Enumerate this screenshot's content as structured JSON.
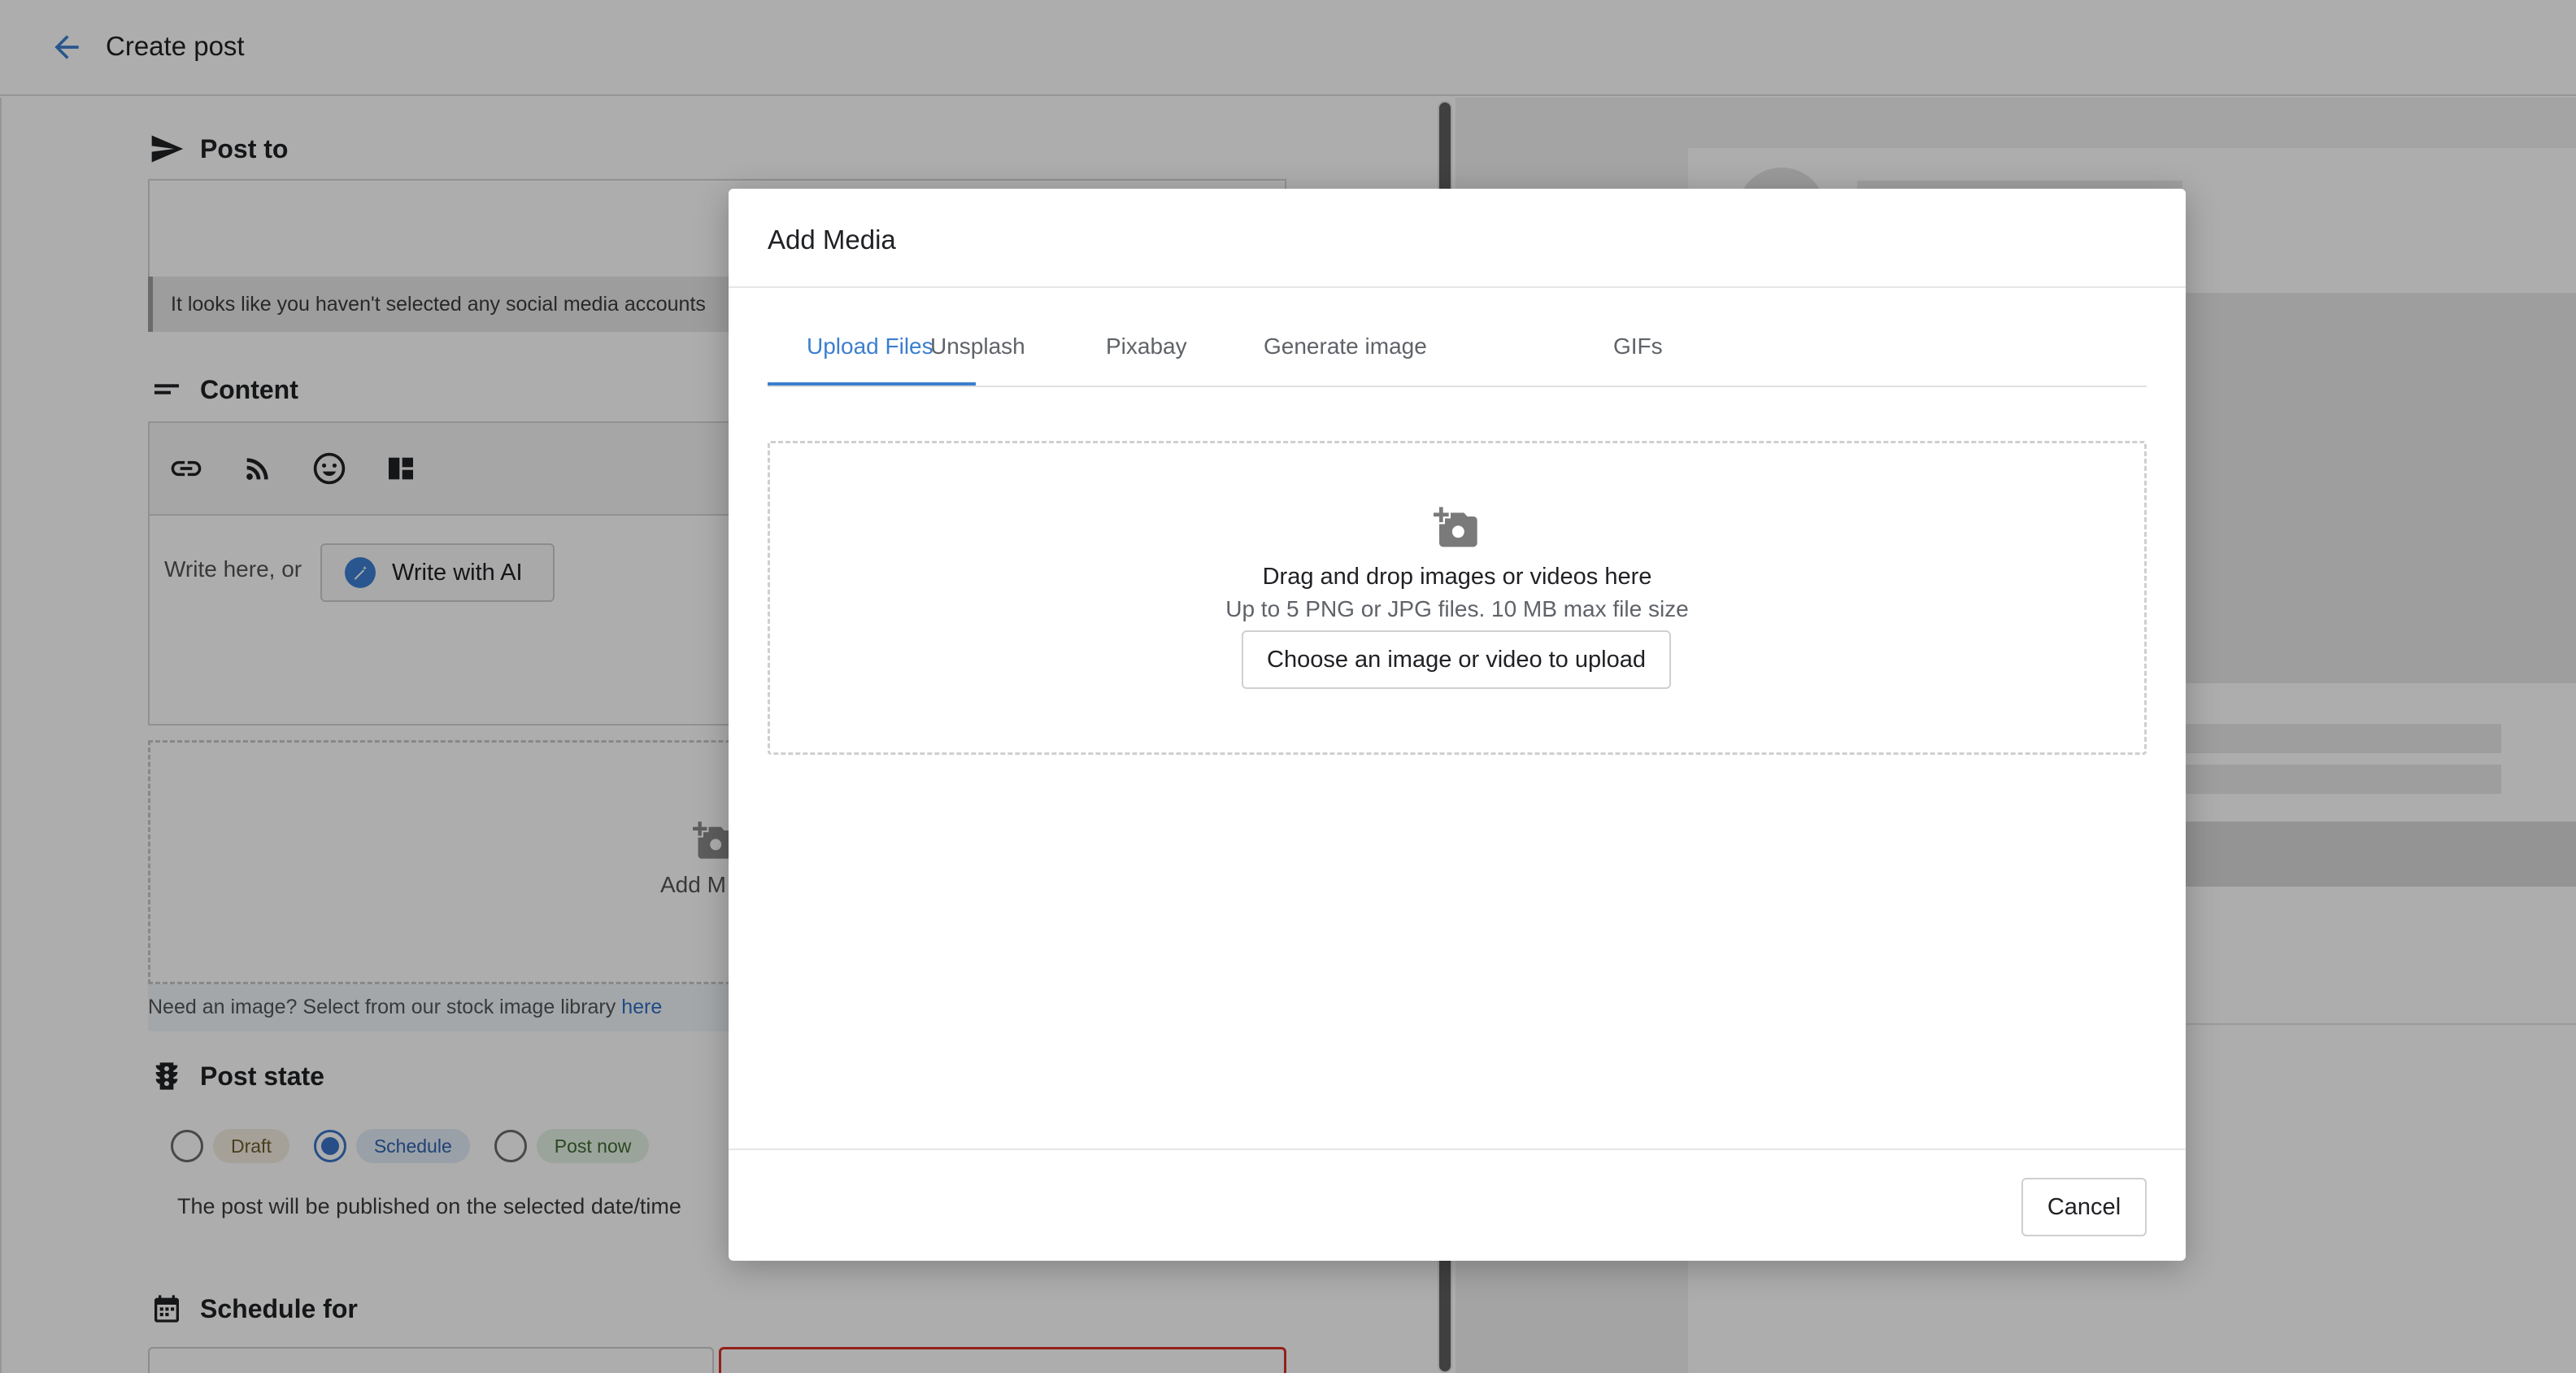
{
  "header": {
    "title": "Create post",
    "back_icon": "arrow-left-icon"
  },
  "post_to": {
    "heading": "Post to",
    "icon": "send-icon",
    "notice": "It looks like you haven't selected any social media accounts"
  },
  "content": {
    "heading": "Content",
    "icon": "text-lines-icon",
    "toolbar_icons": [
      "link-icon",
      "rss-icon",
      "emoji-icon",
      "layout-grid-icon"
    ],
    "placeholder": "Write here, or",
    "ai_button_label": "Write with AI",
    "media_label": "Add M",
    "stock_note": "Need an image? Select from our stock image library",
    "stock_link": "here"
  },
  "post_state": {
    "heading": "Post state",
    "icon": "traffic-light-icon",
    "options": [
      {
        "label": "Draft",
        "checked": false
      },
      {
        "label": "Schedule",
        "checked": true
      },
      {
        "label": "Post now",
        "checked": false
      }
    ],
    "description": "The post will be published on the selected date/time"
  },
  "schedule": {
    "heading": "Schedule for",
    "icon": "calendar-icon"
  },
  "modal": {
    "title": "Add Media",
    "tabs": [
      {
        "label": "Upload Files",
        "active": true
      },
      {
        "label": "Unsplash",
        "active": false
      },
      {
        "label": "Pixabay",
        "active": false
      },
      {
        "label": "Generate image",
        "active": false
      },
      {
        "label": "GIFs",
        "active": false
      }
    ],
    "upload": {
      "icon": "add-photo-icon",
      "title": "Drag and drop images or videos here",
      "subtitle": "Up to 5 PNG or JPG files. 10 MB max file size",
      "button_label": "Choose an image or video to upload"
    },
    "cancel_label": "Cancel"
  },
  "colors": {
    "accent": "#3b7fce",
    "error": "#d93025"
  }
}
